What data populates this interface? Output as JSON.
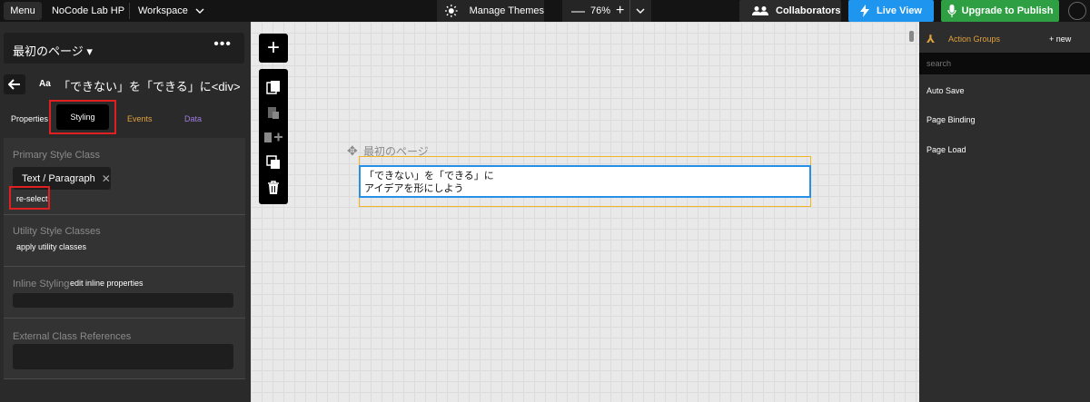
{
  "topbar": {
    "menu_label": "Menu",
    "project_name": "NoCode Lab HP",
    "workspace_label": "Workspace",
    "themes_label": "Manage Themes",
    "zoom_level": "76%",
    "collaborators_label": "Collaborators",
    "live_view_label": "Live View",
    "publish_label": "Upgrade to Publish",
    "colors": {
      "live_view": "#1e96f0",
      "publish": "#2ea043"
    }
  },
  "left_panel": {
    "page_name": "最初のページ",
    "element_icon": "Aa",
    "element_title": "「できない」を「できる」に<div>",
    "tabs": [
      "Properties",
      "Styling",
      "Events",
      "Data"
    ],
    "active_tab": "Styling",
    "primary_style_title": "Primary Style Class",
    "primary_style_chip": "Text / Paragraph",
    "reselect_label": "re-select",
    "utility_title": "Utility Style Classes",
    "utility_action": "apply utility classes",
    "inline_title": "Inline Styling",
    "inline_action": "edit inline properties",
    "external_title": "External Class References"
  },
  "canvas": {
    "page_label": "最初のページ",
    "text_line1": "「できない」を「できる」に",
    "text_line2": "アイデアを形にしよう"
  },
  "right_panel": {
    "title": "Action Groups",
    "new_label": "+ new",
    "search_placeholder": "search",
    "items": [
      "Auto Save",
      "Page Binding",
      "Page Load"
    ]
  }
}
